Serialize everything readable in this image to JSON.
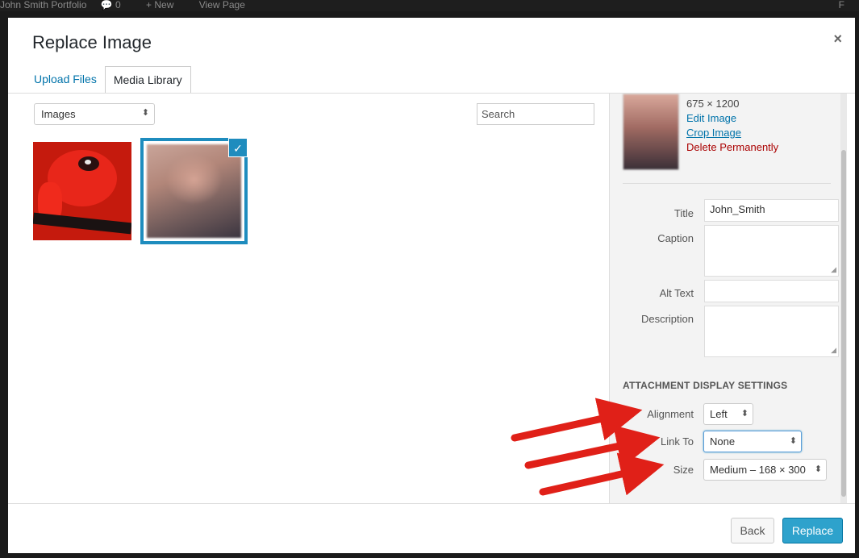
{
  "adminbar": {
    "site": "John Smith Portfolio",
    "comments": "0",
    "new": "New",
    "view": "View Page",
    "right": "F"
  },
  "modal": {
    "title": "Replace Image",
    "close_glyph": "×"
  },
  "tabs": [
    {
      "label": "Upload Files"
    },
    {
      "label": "Media Library"
    }
  ],
  "browser": {
    "filter_value": "Images",
    "search_placeholder": "Search",
    "arrows": "⬍"
  },
  "selected": {
    "check": "✓"
  },
  "details": {
    "dimensions": "675 × 1200",
    "edit": "Edit Image",
    "crop": "Crop Image",
    "delete": "Delete Permanently",
    "title_label": "Title",
    "title_value": "John_Smith",
    "caption_label": "Caption",
    "alt_label": "Alt Text",
    "description_label": "Description"
  },
  "display_settings": {
    "heading": "Attachment Display Settings",
    "alignment_label": "Alignment",
    "alignment_value": "Left",
    "link_label": "Link To",
    "link_value": "None",
    "size_label": "Size",
    "size_value": "Medium – 168 × 300"
  },
  "toolbar": {
    "back": "Back",
    "replace": "Replace"
  },
  "colors": {
    "primary": "#2ea2cc",
    "link": "#0073aa",
    "danger": "#aa0000",
    "arrow": "#e02018"
  }
}
